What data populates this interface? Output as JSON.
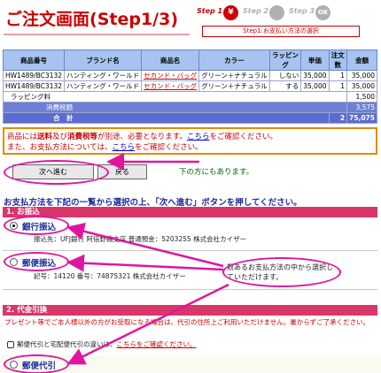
{
  "header": {
    "title": "ご注文画面",
    "step_indicator": "(Step1/3)",
    "steps": [
      {
        "label": "Step 1",
        "icon": "¥",
        "color": "#cc0000"
      },
      {
        "label": "Step 2",
        "icon": "",
        "color": "#b0b0b0"
      },
      {
        "label": "Step 3",
        "icon": "OK",
        "color": "#b0b0b0"
      }
    ],
    "step_caption": "Step1:お支払い方法の選択"
  },
  "order_table": {
    "columns": [
      "商品番号",
      "ブランド名",
      "商品名",
      "カラー",
      "ラッピング",
      "単価",
      "注文数",
      "金額"
    ],
    "rows": [
      {
        "code": "HW1489/BC3132",
        "brand": "ハンティング・ワールド",
        "name": "セカンド・バッグ",
        "color": "グリーン＋ナチュラル",
        "wrapping": "しない",
        "price": "35,000",
        "qty": "1",
        "amount": "35,000"
      },
      {
        "code": "HW1489/BC3132",
        "brand": "ハンティング・ワールド",
        "name": "セカンド・バッグ",
        "color": "グリーン＋ナチュラル",
        "wrapping": "する",
        "price": "35,000",
        "qty": "1",
        "amount": "35,000"
      }
    ],
    "wrapping_fee_label": "ラッピング料",
    "wrapping_fee_amount": "1,500",
    "tax_label": "消費税額",
    "tax_amount": "3,575",
    "total_label": "合　計",
    "total_qty": "2",
    "total_amount": "75,075"
  },
  "notice": {
    "line1_a": "商品には",
    "line1_b": "送料",
    "line1_c": "及び",
    "line1_d": "消費税等",
    "line1_e": "が別途、必要となります。",
    "line1_link": "こちら",
    "line1_f": "をご確認ください。",
    "line2_a": "また、お支払方法については、",
    "line2_link": "こちら",
    "line2_b": "をご確認ください。"
  },
  "buttons": {
    "next": "次へ進む",
    "back": "戻る",
    "below_note": "下の方にもあります。"
  },
  "instruction": "お支払方法を下記の一覧から選択の上、「次へ進む」ボタンを押してください。",
  "section1": {
    "title": "1. お振込",
    "bank": {
      "label": "銀行振込",
      "detail": "振込先：UFJ銀行 阿倍野橋支店 普通預金：5203255 株式会社カイザー"
    },
    "postal": {
      "label": "郵便振込",
      "detail": "記号：14120 番号：74875321 株式会社カイザー"
    }
  },
  "callout": "数あるお支払方法の中から選択していただけます。",
  "section2": {
    "title": "2. 代金引換",
    "warning": "プレゼント等でご本人様以外の方がお受取になる場合は、代引の住所上ご利用いただけません。裏からずご了承ください。",
    "info_text": "郵便代引と宅配便代引の違いは、",
    "info_link": "こちらをご確認ください。",
    "cod": {
      "label": "郵便代引"
    }
  },
  "colors": {
    "accent": "#cc0000",
    "section_bar": "#d9366a",
    "highlight": "#e0159f",
    "table_header": "#a7c4f0"
  }
}
